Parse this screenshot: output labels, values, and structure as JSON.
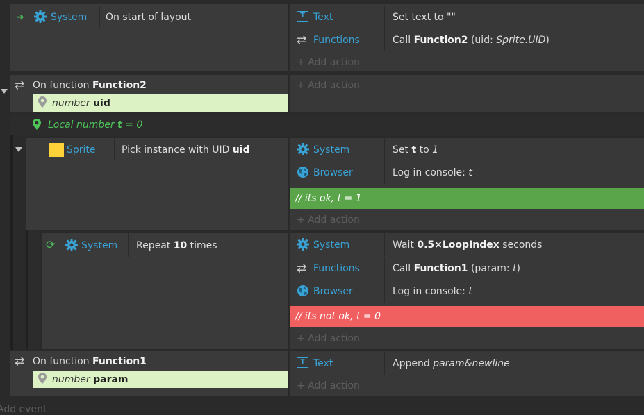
{
  "colors": {
    "object": "#3aa3d6",
    "comment_ok": "#5aa54a",
    "comment_bad": "#f06060",
    "param_bg": "#dcf2c4",
    "local_var": "#4fc35a"
  },
  "events": {
    "e1": {
      "cond_obj": "System",
      "cond_text": "On start of layout",
      "actions": [
        {
          "obj": "Text",
          "icon": "text-object-icon",
          "pre": "Set text to \"\"",
          "b": "",
          "post": ""
        },
        {
          "obj": "Functions",
          "icon": "functions-icon",
          "pre": "Call ",
          "b": "Function2",
          "post": " (uid: ",
          "it": "Sprite.UID",
          "post2": ")"
        }
      ],
      "add_action": "+ Add action"
    },
    "e2": {
      "label": "On function ",
      "name": "Function2",
      "param_type": "number",
      "param_name": "uid",
      "add_action": "+ Add action",
      "local_var": {
        "pre": "Local number ",
        "name": "t",
        "post": " = 0"
      }
    },
    "e2a": {
      "cond_obj": "Sprite",
      "cond_pre": "Pick instance with UID ",
      "cond_b": "uid",
      "a1": {
        "obj": "System",
        "pre": "Set ",
        "b": "t",
        "mid": " to ",
        "it": "1"
      },
      "a2": {
        "obj": "Browser",
        "pre": "Log in console: ",
        "it": "t"
      },
      "comment": "//  its ok, t = 1",
      "add_action": "+ Add action"
    },
    "e2b": {
      "cond_obj": "System",
      "cond_pre": "Repeat ",
      "cond_b": "10",
      "cond_post": " times",
      "a1": {
        "obj": "System",
        "pre": "Wait ",
        "b": "0.5×LoopIndex",
        "post": " seconds"
      },
      "a2": {
        "obj": "Functions",
        "pre": "Call ",
        "b": "Function1",
        "post": " (param: ",
        "it": "t",
        "post2": ")"
      },
      "a3": {
        "obj": "Browser",
        "pre": "Log in console: ",
        "it": "t"
      },
      "comment": "//  its not ok, t = 0",
      "add_action": "+ Add action"
    },
    "e3": {
      "label": "On function ",
      "name": "Function1",
      "param_type": "number",
      "param_name": "param",
      "a1": {
        "obj": "Text",
        "pre": "Append ",
        "it": "param&newline"
      },
      "add_action": "+ Add action"
    }
  },
  "footer": {
    "add_event": "Add event"
  }
}
